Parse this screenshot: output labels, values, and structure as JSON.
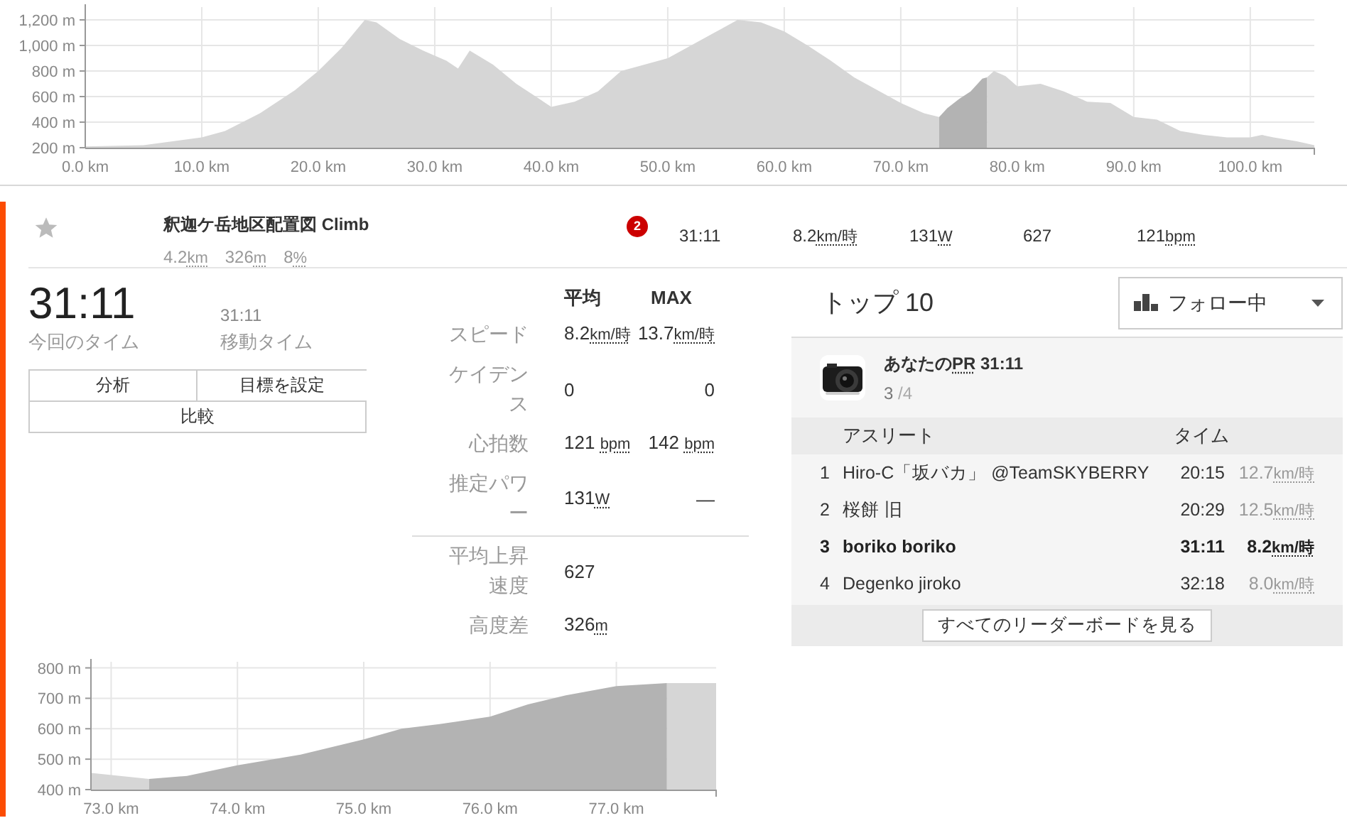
{
  "elevation_chart": {
    "chart_data": {
      "type": "area",
      "grid": true,
      "xlim": [
        0,
        105.5
      ],
      "ylim": [
        200,
        1300
      ],
      "x": [
        0,
        5,
        10,
        12,
        15,
        18,
        20,
        22,
        24,
        25,
        27,
        29,
        31,
        32,
        33,
        35,
        37,
        39,
        40,
        42,
        44,
        46,
        48,
        50,
        52,
        54,
        56,
        58,
        60,
        62,
        64,
        66,
        68,
        70,
        72,
        73.3,
        74,
        75,
        76,
        77,
        77.4,
        78,
        79,
        80,
        82,
        84,
        86,
        88,
        90,
        92,
        94,
        96,
        98,
        100,
        101,
        102,
        104,
        105.5
      ],
      "series": [
        {
          "color": "#d6d6d6",
          "values": [
            210,
            220,
            280,
            330,
            470,
            650,
            800,
            980,
            1200,
            1180,
            1050,
            960,
            880,
            820,
            960,
            850,
            700,
            580,
            520,
            560,
            640,
            800,
            850,
            900,
            1000,
            1100,
            1200,
            1180,
            1110,
            1000,
            880,
            750,
            650,
            550,
            470,
            440,
            null,
            null,
            null,
            null,
            750,
            800,
            760,
            680,
            700,
            640,
            560,
            550,
            440,
            420,
            330,
            300,
            280,
            280,
            300,
            280,
            250,
            220
          ]
        },
        {
          "color": "#b3b3b3",
          "values": [
            null,
            null,
            null,
            null,
            null,
            null,
            null,
            null,
            null,
            null,
            null,
            null,
            null,
            null,
            null,
            null,
            null,
            null,
            null,
            null,
            null,
            null,
            null,
            null,
            null,
            null,
            null,
            null,
            null,
            null,
            null,
            null,
            null,
            null,
            null,
            440,
            510,
            580,
            640,
            740,
            750,
            null,
            null,
            null,
            null,
            null,
            null,
            null,
            null,
            null,
            null,
            null,
            null,
            null,
            null,
            null,
            null,
            null
          ]
        }
      ],
      "yticks": [
        {
          "value": 200,
          "label": "200 m"
        },
        {
          "value": 400,
          "label": "400 m"
        },
        {
          "value": 600,
          "label": "600 m"
        },
        {
          "value": 800,
          "label": "800 m"
        },
        {
          "value": 1000,
          "label": "1,000 m"
        },
        {
          "value": 1200,
          "label": "1,200 m"
        }
      ],
      "xticks": [
        {
          "value": 0,
          "label": "0.0 km"
        },
        {
          "value": 10,
          "label": "10.0 km"
        },
        {
          "value": 20,
          "label": "20.0 km"
        },
        {
          "value": 30,
          "label": "30.0 km"
        },
        {
          "value": 40,
          "label": "40.0 km"
        },
        {
          "value": 50,
          "label": "50.0 km"
        },
        {
          "value": 60,
          "label": "60.0 km"
        },
        {
          "value": 70,
          "label": "70.0 km"
        },
        {
          "value": 80,
          "label": "80.0 km"
        },
        {
          "value": 90,
          "label": "90.0 km"
        },
        {
          "value": 100,
          "label": "100.0 km"
        }
      ]
    }
  },
  "segment": {
    "starred": false,
    "name": "釈迦ケ岳地区配置図 Climb",
    "stats": [
      {
        "value": "4.2",
        "unit": "km"
      },
      {
        "value": "326",
        "unit": "m"
      },
      {
        "value": "8",
        "unit": "%"
      }
    ],
    "rank_badge": "2",
    "time": "31:11",
    "speed": {
      "value": "8.2",
      "unit": "km/時"
    },
    "power": {
      "value": "131",
      "unit": "W"
    },
    "vam": {
      "value": "627"
    },
    "heart_rate": {
      "value": "121",
      "unit": "bpm"
    }
  },
  "effort": {
    "time": "31:11",
    "time_label": "今回のタイム",
    "moving_time": "31:11",
    "moving_time_label": "移動タイム",
    "buttons": [
      "分析",
      "目標を設定",
      "比較"
    ]
  },
  "stats_table": {
    "columns": [
      "平均",
      "MAX"
    ],
    "rows": [
      {
        "label": "スピード",
        "avg": {
          "value": "8.2",
          "unit": "km/時"
        },
        "max": {
          "value": "13.7",
          "unit": "km/時"
        }
      },
      {
        "label": "ケイデンス",
        "avg": {
          "value": "0"
        },
        "max": {
          "value": "0"
        }
      },
      {
        "label": "心拍数",
        "avg": {
          "value": "121 ",
          "unit": "bpm"
        },
        "max": {
          "value": "142 ",
          "unit": "bpm"
        }
      },
      {
        "label": "推定パワー",
        "avg": {
          "value": "131",
          "unit": "W"
        },
        "max": {
          "value": "—"
        }
      },
      {
        "label": "平均上昇速度",
        "divider": true,
        "avg": {
          "value": "627"
        }
      },
      {
        "label": "高度差",
        "avg": {
          "value": "326",
          "unit": "m"
        }
      }
    ]
  },
  "elevation_detail_chart": {
    "chart_data": {
      "type": "area",
      "grid": true,
      "xlim": [
        72.84,
        77.79
      ],
      "ylim": [
        400,
        820
      ],
      "x": [
        72.84,
        73.3,
        73.6,
        74.0,
        74.5,
        75.0,
        75.3,
        75.6,
        76.0,
        76.3,
        76.6,
        77.0,
        77.4,
        77.79
      ],
      "series": [
        {
          "color": "#d6d6d6",
          "values": [
            455,
            435,
            null,
            null,
            null,
            null,
            null,
            null,
            null,
            null,
            null,
            null,
            750,
            750
          ]
        },
        {
          "color": "#b3b3b3",
          "values": [
            null,
            435,
            445,
            480,
            515,
            565,
            600,
            615,
            640,
            680,
            710,
            740,
            750,
            null
          ]
        }
      ],
      "yticks": [
        {
          "value": 400,
          "label": "400 m"
        },
        {
          "value": 500,
          "label": "500 m"
        },
        {
          "value": 600,
          "label": "600 m"
        },
        {
          "value": 700,
          "label": "700 m"
        },
        {
          "value": 800,
          "label": "800 m"
        }
      ],
      "xticks": [
        {
          "value": 73,
          "label": "73.0 km"
        },
        {
          "value": 74,
          "label": "74.0 km"
        },
        {
          "value": 75,
          "label": "75.0 km"
        },
        {
          "value": 76,
          "label": "76.0 km"
        },
        {
          "value": 77,
          "label": "77.0 km"
        }
      ]
    }
  },
  "leaderboard": {
    "title": "トップ 10",
    "filter": "フォロー中",
    "pr": {
      "prefix": "あなたの",
      "abbr": "PR",
      "time": " 31:11",
      "rank": "3",
      "total": " /4"
    },
    "columns": [
      "アスリート",
      "タイム"
    ],
    "rows": [
      {
        "rank": "1",
        "athlete": "Hiro-C「坂バカ」 @TeamSKYBERRY",
        "time": "20:15",
        "speed": "12.7",
        "unit": "km/時",
        "highlighted": false
      },
      {
        "rank": "2",
        "athlete": "桜餅 旧",
        "time": "20:29",
        "speed": "12.5",
        "unit": "km/時",
        "highlighted": false
      },
      {
        "rank": "3",
        "athlete": "boriko boriko",
        "time": "31:11",
        "speed": "8.2",
        "unit": "km/時",
        "highlighted": true
      },
      {
        "rank": "4",
        "athlete": "Degenko jiroko",
        "time": "32:18",
        "speed": "8.0",
        "unit": "km/時",
        "highlighted": false
      }
    ],
    "view_all_button": "すべてのリーダーボードを見る"
  }
}
